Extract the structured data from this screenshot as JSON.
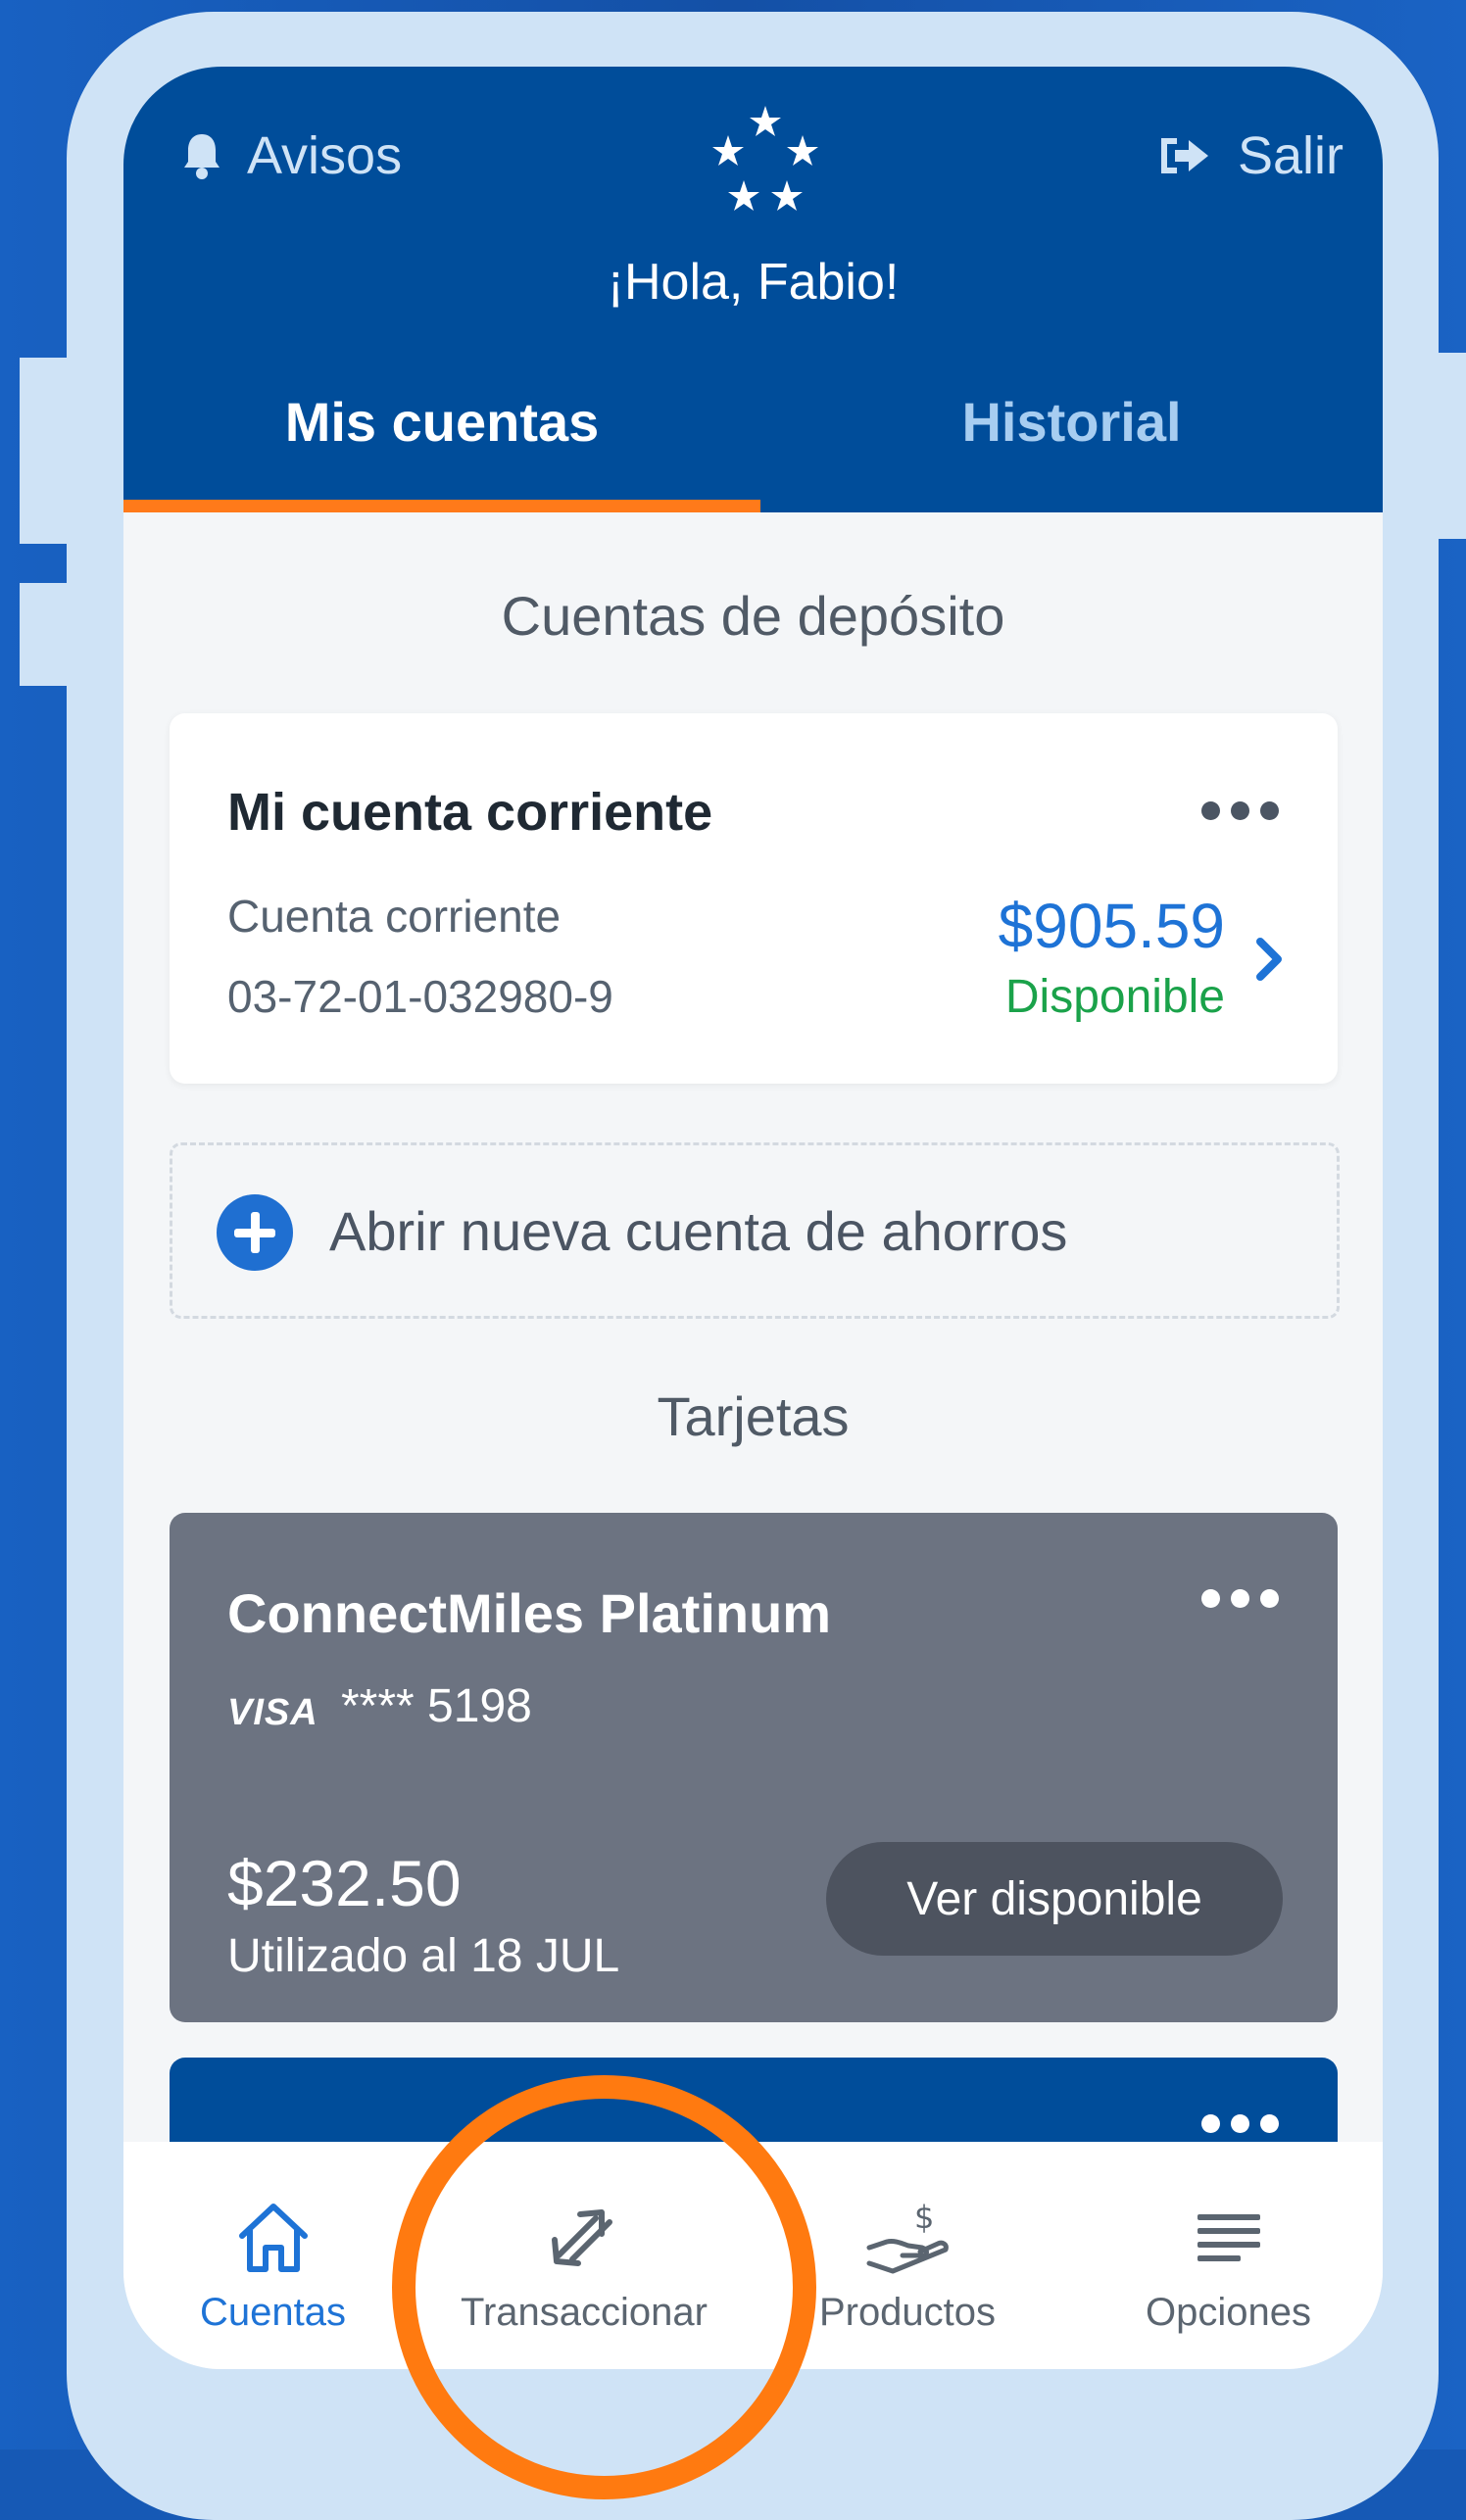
{
  "header": {
    "notifications_label": "Avisos",
    "logout_label": "Salir",
    "logo": "star-alliance-logo",
    "greeting": "¡Hola, Fabio!",
    "tabs": [
      {
        "label": "Mis cuentas",
        "active": true
      },
      {
        "label": "Historial",
        "active": false
      }
    ],
    "accent_color": "#ff7a1a",
    "brand_color": "#004d9a"
  },
  "deposits": {
    "section_title": "Cuentas de depósito",
    "account": {
      "name": "Mi cuenta corriente",
      "type": "Cuenta corriente",
      "number": "03-72-01-032980-9",
      "amount": "$905.59",
      "status": "Disponible"
    },
    "new_account_label": "Abrir nueva cuenta de ahorros"
  },
  "cards": {
    "section_title": "Tarjetas",
    "items": [
      {
        "name": "ConnectMiles Platinum",
        "brand": "VISA",
        "masked_number": "**** 5198",
        "amount": "$232.50",
        "used_label": "Utilizado al 18 JUL",
        "button_label": "Ver disponible"
      }
    ]
  },
  "bottom_nav": [
    {
      "label": "Cuentas",
      "icon": "home-icon",
      "active": true
    },
    {
      "label": "Transaccionar",
      "icon": "transfer-icon",
      "active": false
    },
    {
      "label": "Productos",
      "icon": "hand-money-icon",
      "active": false
    },
    {
      "label": "Opciones",
      "icon": "menu-icon",
      "active": false
    }
  ]
}
